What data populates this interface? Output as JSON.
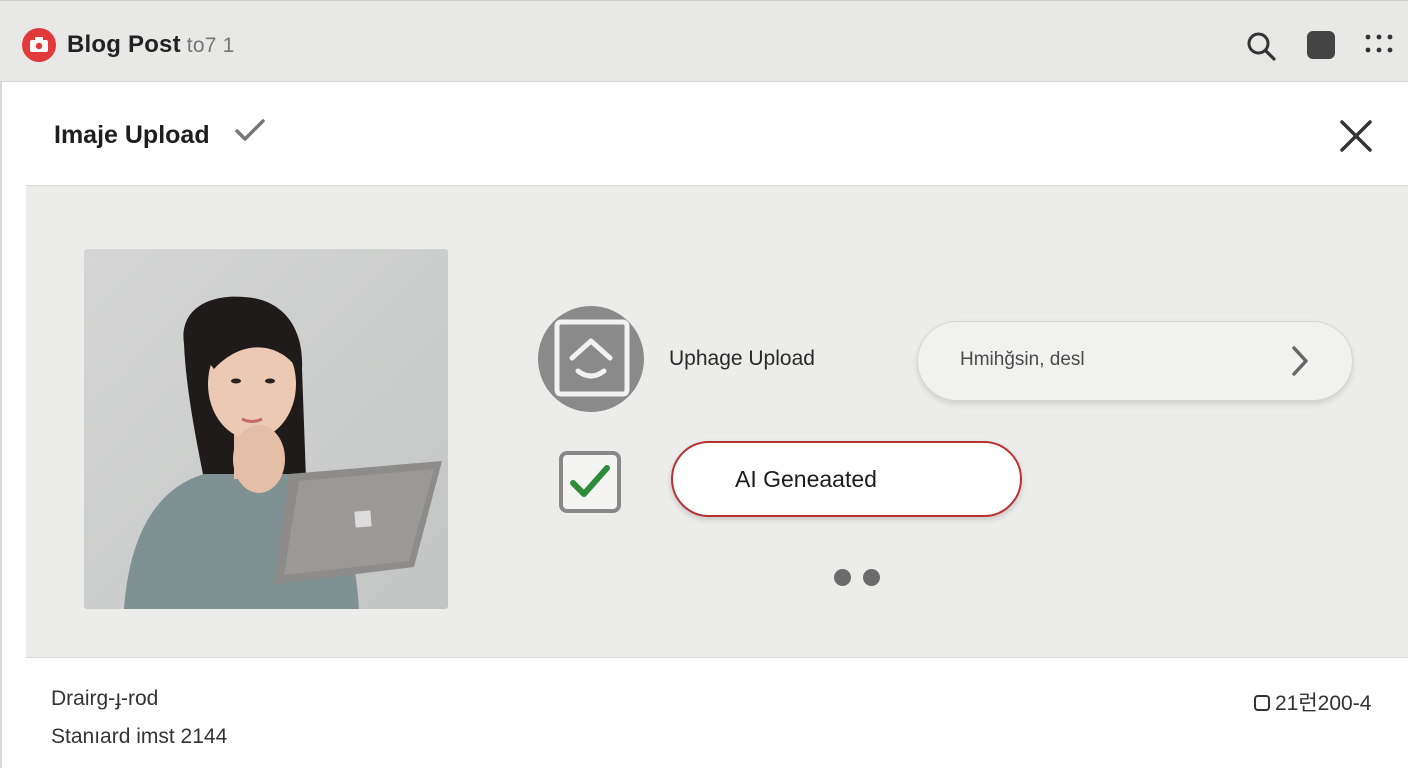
{
  "app": {
    "title": "Blog Post",
    "title_suffix": "to7 1",
    "brand_color": "#e03a3a",
    "app_icon": "camera-icon"
  },
  "toolbar": {
    "search_icon": "search-icon",
    "square_icon": "square-icon",
    "grid_icon": "grid-icon"
  },
  "dialog": {
    "title": "Imaje Upload",
    "title_icon": "check-icon",
    "close_icon": "close-icon"
  },
  "upload": {
    "label": "Uphage Upload",
    "icon": "upload-icon"
  },
  "name_field": {
    "value": "Hmihğsin, desl",
    "icon": "chevron-right-icon"
  },
  "ai_checkbox": {
    "checked": true,
    "check_color": "#2e8b3a"
  },
  "ai_button": {
    "label": "AI Geneaated",
    "border_color": "#b93131"
  },
  "pagination": {
    "dots": 2
  },
  "footer": {
    "line1": "Drairg-ɟ-rod",
    "line2": "Stanıard imst 2144",
    "right_text": "21런200-4"
  }
}
